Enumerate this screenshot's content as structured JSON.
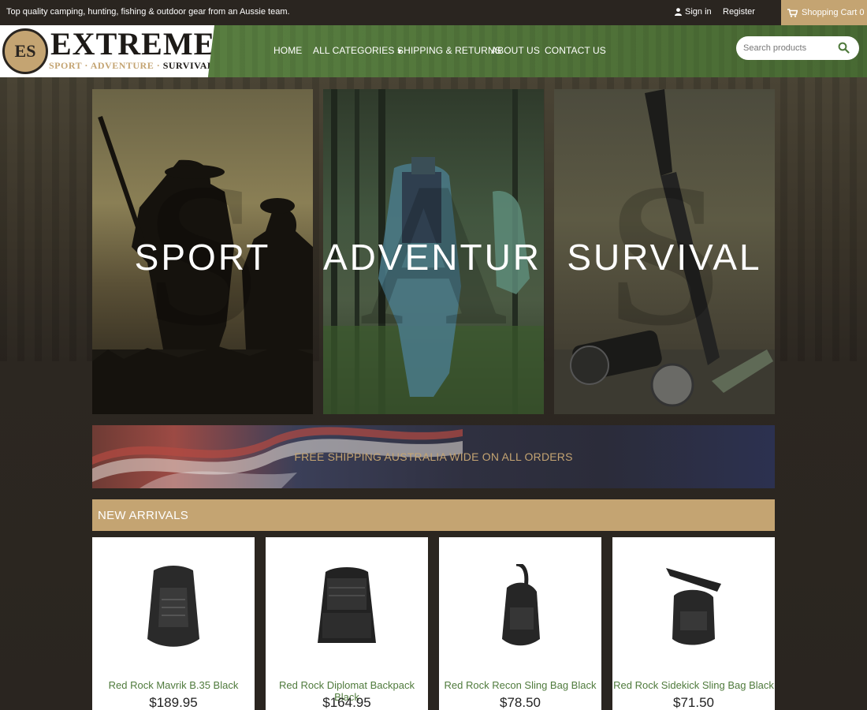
{
  "topbar": {
    "tagline": "Top quality camping, hunting, fishing & outdoor gear from an Aussie team.",
    "signin": "Sign in",
    "register": "Register",
    "cart": "Shopping Cart 0"
  },
  "logo": {
    "emblem": "ES",
    "word": "EXTREME",
    "sub_1": "SPORT · ADVENTURE ·",
    "sub_2": " SURVIVAL"
  },
  "nav": {
    "home": "HOME",
    "categories": "ALL CATEGORIES",
    "shipping": "SHIPPING & RETURNS",
    "about": "ABOUT US",
    "contact": "CONTACT US"
  },
  "search": {
    "placeholder": "Search products"
  },
  "tiles": [
    {
      "label": "SPORT",
      "ghost": "S"
    },
    {
      "label": "ADVENTURE",
      "ghost": "A"
    },
    {
      "label": "SURVIVAL",
      "ghost": "S"
    }
  ],
  "banner": {
    "text": "FREE SHIPPING AUSTRALIA WIDE ON ALL ORDERS"
  },
  "arrivals": {
    "title": "NEW ARRIVALS",
    "products": [
      {
        "name": "Red Rock Mavrik B.35 Black",
        "price": "$189.95"
      },
      {
        "name": "Red Rock Diplomat Backpack Black",
        "price": "$164.95"
      },
      {
        "name": "Red Rock Recon Sling Bag Black",
        "price": "$78.50"
      },
      {
        "name": "Red Rock Sidekick Sling Bag Black",
        "price": "$71.50"
      }
    ]
  },
  "colors": {
    "accent_tan": "#c4a472",
    "header_green": "#557a3e",
    "link_green": "#4f7a3c",
    "dark_bg": "#2a2520"
  }
}
